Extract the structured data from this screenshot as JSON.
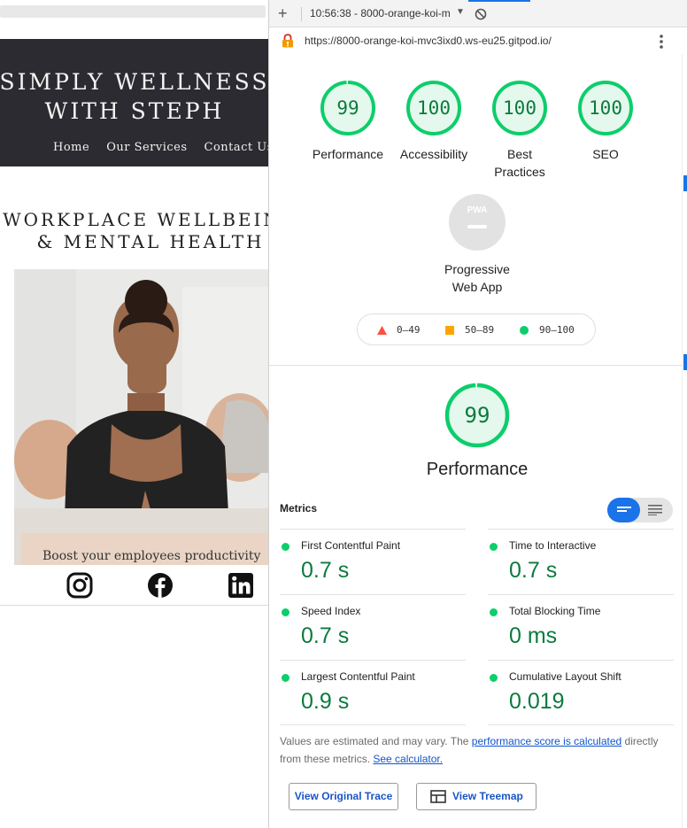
{
  "site": {
    "brand": "SIMPLY WELLNESS\nWITH STEPH",
    "nav": [
      "Home",
      "Our Services",
      "Contact Us"
    ],
    "heading": "WORKPLACE WELLBEING\n& MENTAL HEALTH",
    "caption": "Boost your employees productivity",
    "social": [
      "instagram-icon",
      "facebook-icon",
      "linkedin-icon"
    ]
  },
  "devtools": {
    "report_select": "10:56:38 - 8000-orange-koi-m",
    "url": "https://8000-orange-koi-mvc3ixd0.ws-eu25.gitpod.io/"
  },
  "gauges": [
    {
      "label": "Performance",
      "score": 99
    },
    {
      "label": "Accessibility",
      "score": 100
    },
    {
      "label": "Best\nPractices",
      "score": 100
    },
    {
      "label": "SEO",
      "score": 100
    }
  ],
  "pwa": {
    "badge": "PWA",
    "label": "Progressive\nWeb App"
  },
  "legend": [
    {
      "range": "0–49",
      "color": "#ff4e42"
    },
    {
      "range": "50–89",
      "color": "#ffa400"
    },
    {
      "range": "90–100",
      "color": "#0cce6b"
    }
  ],
  "performance": {
    "score": 99,
    "label": "Performance"
  },
  "metrics_title": "Metrics",
  "metrics": [
    {
      "label": "First Contentful Paint",
      "value": "0.7 s"
    },
    {
      "label": "Time to Interactive",
      "value": "0.7 s"
    },
    {
      "label": "Speed Index",
      "value": "0.7 s"
    },
    {
      "label": "Total Blocking Time",
      "value": "0 ms"
    },
    {
      "label": "Largest Contentful Paint",
      "value": "0.9 s"
    },
    {
      "label": "Cumulative Layout Shift",
      "value": "0.019"
    }
  ],
  "footnote": {
    "part1": "Values are estimated and may vary. The ",
    "link1": "performance score is calculated",
    "part2": " directly from these metrics. ",
    "link2": "See calculator."
  },
  "buttons": {
    "trace": "View Original Trace",
    "treemap": "View Treemap"
  },
  "colors": {
    "pass": "#0cce6b",
    "pass_text": "#0c7a3f",
    "accent": "#1a73e8",
    "site_header": "#2c2b31"
  }
}
